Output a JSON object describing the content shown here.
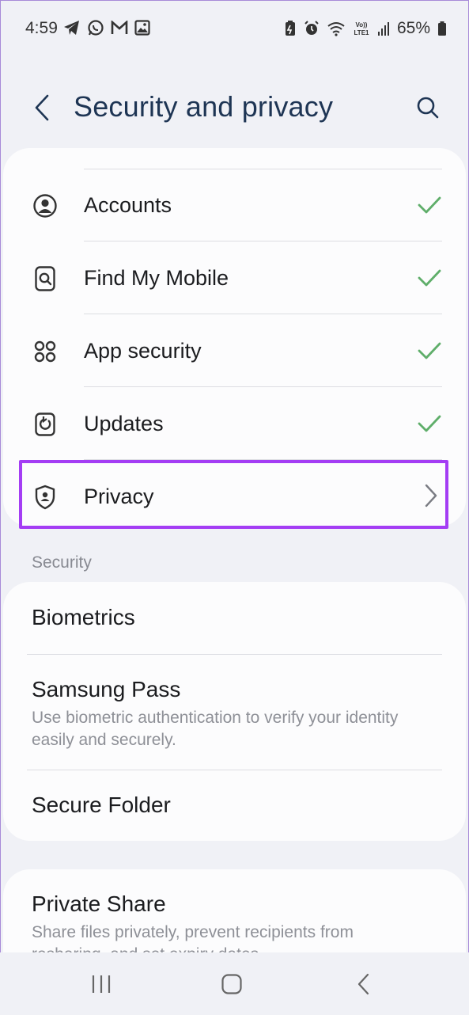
{
  "status_bar": {
    "time": "4:59",
    "battery": "65%",
    "left_icons": [
      "telegram-icon",
      "whatsapp-icon",
      "gmail-icon",
      "gallery-icon"
    ],
    "right_icons": [
      "battery-saver-icon",
      "alarm-icon",
      "wifi-icon",
      "volte-icon",
      "signal-icon",
      "battery-icon"
    ]
  },
  "header": {
    "title": "Security and privacy"
  },
  "top_card": {
    "items": [
      {
        "label": "Accounts",
        "icon": "account-icon",
        "status": "check"
      },
      {
        "label": "Find My Mobile",
        "icon": "find-my-mobile-icon",
        "status": "check"
      },
      {
        "label": "App security",
        "icon": "app-security-icon",
        "status": "check"
      },
      {
        "label": "Updates",
        "icon": "updates-icon",
        "status": "check"
      },
      {
        "label": "Privacy",
        "icon": "privacy-shield-icon",
        "status": "chevron"
      }
    ]
  },
  "security_section": {
    "header": "Security",
    "items": [
      {
        "title": "Biometrics",
        "subtitle": ""
      },
      {
        "title": "Samsung Pass",
        "subtitle": "Use biometric authentication to verify your identity easily and securely."
      },
      {
        "title": "Secure Folder",
        "subtitle": ""
      }
    ]
  },
  "bottom_card": {
    "title": "Private Share",
    "subtitle": "Share files privately, prevent recipients from resharing, and set expiry dates."
  },
  "colors": {
    "accent_title": "#1e3554",
    "check_green": "#5fae6a",
    "highlight": "#a43df4",
    "background": "#f0f1f6"
  },
  "nav_bar": {
    "buttons": [
      "recents-icon",
      "home-icon",
      "back-icon"
    ]
  }
}
